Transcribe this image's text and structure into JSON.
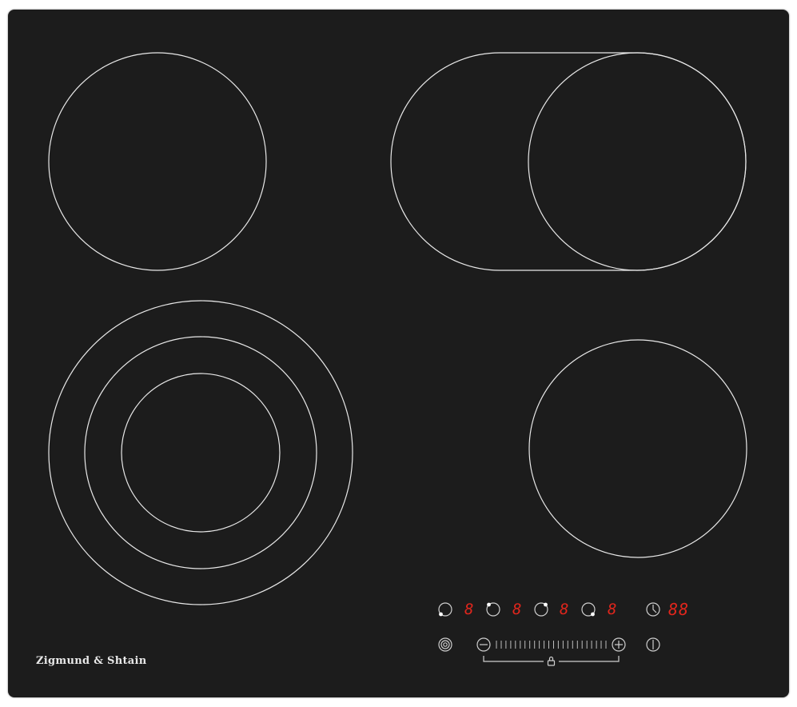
{
  "brand": {
    "name": "Zigmund & Shtain"
  },
  "colors": {
    "glass": "#1c1c1c",
    "zone_outline": "#e8e8e8",
    "display": "#e1261c",
    "controls": "#cfcfcf"
  },
  "zones": [
    {
      "id": "rear-left",
      "type": "single"
    },
    {
      "id": "rear-right",
      "type": "extended-oval"
    },
    {
      "id": "front-left",
      "type": "triple-ring"
    },
    {
      "id": "front-right",
      "type": "single"
    }
  ],
  "control_panel": {
    "zone_selectors": [
      {
        "icon": "zone-selector-front-left-icon",
        "display": "8"
      },
      {
        "icon": "zone-selector-rear-left-icon",
        "display": "8"
      },
      {
        "icon": "zone-selector-rear-right-icon",
        "display": "8"
      },
      {
        "icon": "zone-selector-front-right-icon",
        "display": "8"
      }
    ],
    "timer": {
      "icon": "clock-icon",
      "display": "88"
    },
    "slider": {
      "minus_icon": "minus-icon",
      "plus_icon": "plus-icon",
      "lock_icon": "lock-icon"
    },
    "extra_zone_icon": "dual-ring-icon",
    "power_icon": "power-icon"
  }
}
